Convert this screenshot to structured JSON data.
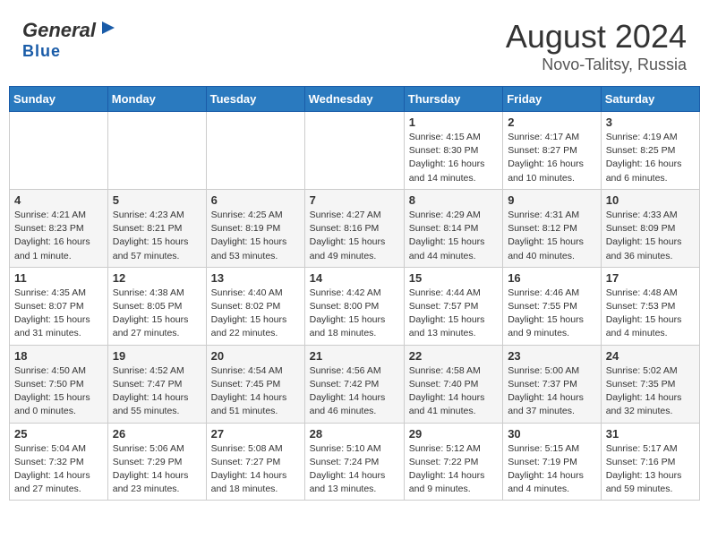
{
  "header": {
    "logo_general": "General",
    "logo_blue": "Blue",
    "title": "August 2024",
    "location": "Novo-Talitsy, Russia"
  },
  "days_of_week": [
    "Sunday",
    "Monday",
    "Tuesday",
    "Wednesday",
    "Thursday",
    "Friday",
    "Saturday"
  ],
  "weeks": [
    [
      {
        "day": "",
        "info": ""
      },
      {
        "day": "",
        "info": ""
      },
      {
        "day": "",
        "info": ""
      },
      {
        "day": "",
        "info": ""
      },
      {
        "day": "1",
        "info": "Sunrise: 4:15 AM\nSunset: 8:30 PM\nDaylight: 16 hours\nand 14 minutes."
      },
      {
        "day": "2",
        "info": "Sunrise: 4:17 AM\nSunset: 8:27 PM\nDaylight: 16 hours\nand 10 minutes."
      },
      {
        "day": "3",
        "info": "Sunrise: 4:19 AM\nSunset: 8:25 PM\nDaylight: 16 hours\nand 6 minutes."
      }
    ],
    [
      {
        "day": "4",
        "info": "Sunrise: 4:21 AM\nSunset: 8:23 PM\nDaylight: 16 hours\nand 1 minute."
      },
      {
        "day": "5",
        "info": "Sunrise: 4:23 AM\nSunset: 8:21 PM\nDaylight: 15 hours\nand 57 minutes."
      },
      {
        "day": "6",
        "info": "Sunrise: 4:25 AM\nSunset: 8:19 PM\nDaylight: 15 hours\nand 53 minutes."
      },
      {
        "day": "7",
        "info": "Sunrise: 4:27 AM\nSunset: 8:16 PM\nDaylight: 15 hours\nand 49 minutes."
      },
      {
        "day": "8",
        "info": "Sunrise: 4:29 AM\nSunset: 8:14 PM\nDaylight: 15 hours\nand 44 minutes."
      },
      {
        "day": "9",
        "info": "Sunrise: 4:31 AM\nSunset: 8:12 PM\nDaylight: 15 hours\nand 40 minutes."
      },
      {
        "day": "10",
        "info": "Sunrise: 4:33 AM\nSunset: 8:09 PM\nDaylight: 15 hours\nand 36 minutes."
      }
    ],
    [
      {
        "day": "11",
        "info": "Sunrise: 4:35 AM\nSunset: 8:07 PM\nDaylight: 15 hours\nand 31 minutes."
      },
      {
        "day": "12",
        "info": "Sunrise: 4:38 AM\nSunset: 8:05 PM\nDaylight: 15 hours\nand 27 minutes."
      },
      {
        "day": "13",
        "info": "Sunrise: 4:40 AM\nSunset: 8:02 PM\nDaylight: 15 hours\nand 22 minutes."
      },
      {
        "day": "14",
        "info": "Sunrise: 4:42 AM\nSunset: 8:00 PM\nDaylight: 15 hours\nand 18 minutes."
      },
      {
        "day": "15",
        "info": "Sunrise: 4:44 AM\nSunset: 7:57 PM\nDaylight: 15 hours\nand 13 minutes."
      },
      {
        "day": "16",
        "info": "Sunrise: 4:46 AM\nSunset: 7:55 PM\nDaylight: 15 hours\nand 9 minutes."
      },
      {
        "day": "17",
        "info": "Sunrise: 4:48 AM\nSunset: 7:53 PM\nDaylight: 15 hours\nand 4 minutes."
      }
    ],
    [
      {
        "day": "18",
        "info": "Sunrise: 4:50 AM\nSunset: 7:50 PM\nDaylight: 15 hours\nand 0 minutes."
      },
      {
        "day": "19",
        "info": "Sunrise: 4:52 AM\nSunset: 7:47 PM\nDaylight: 14 hours\nand 55 minutes."
      },
      {
        "day": "20",
        "info": "Sunrise: 4:54 AM\nSunset: 7:45 PM\nDaylight: 14 hours\nand 51 minutes."
      },
      {
        "day": "21",
        "info": "Sunrise: 4:56 AM\nSunset: 7:42 PM\nDaylight: 14 hours\nand 46 minutes."
      },
      {
        "day": "22",
        "info": "Sunrise: 4:58 AM\nSunset: 7:40 PM\nDaylight: 14 hours\nand 41 minutes."
      },
      {
        "day": "23",
        "info": "Sunrise: 5:00 AM\nSunset: 7:37 PM\nDaylight: 14 hours\nand 37 minutes."
      },
      {
        "day": "24",
        "info": "Sunrise: 5:02 AM\nSunset: 7:35 PM\nDaylight: 14 hours\nand 32 minutes."
      }
    ],
    [
      {
        "day": "25",
        "info": "Sunrise: 5:04 AM\nSunset: 7:32 PM\nDaylight: 14 hours\nand 27 minutes."
      },
      {
        "day": "26",
        "info": "Sunrise: 5:06 AM\nSunset: 7:29 PM\nDaylight: 14 hours\nand 23 minutes."
      },
      {
        "day": "27",
        "info": "Sunrise: 5:08 AM\nSunset: 7:27 PM\nDaylight: 14 hours\nand 18 minutes."
      },
      {
        "day": "28",
        "info": "Sunrise: 5:10 AM\nSunset: 7:24 PM\nDaylight: 14 hours\nand 13 minutes."
      },
      {
        "day": "29",
        "info": "Sunrise: 5:12 AM\nSunset: 7:22 PM\nDaylight: 14 hours\nand 9 minutes."
      },
      {
        "day": "30",
        "info": "Sunrise: 5:15 AM\nSunset: 7:19 PM\nDaylight: 14 hours\nand 4 minutes."
      },
      {
        "day": "31",
        "info": "Sunrise: 5:17 AM\nSunset: 7:16 PM\nDaylight: 13 hours\nand 59 minutes."
      }
    ]
  ]
}
